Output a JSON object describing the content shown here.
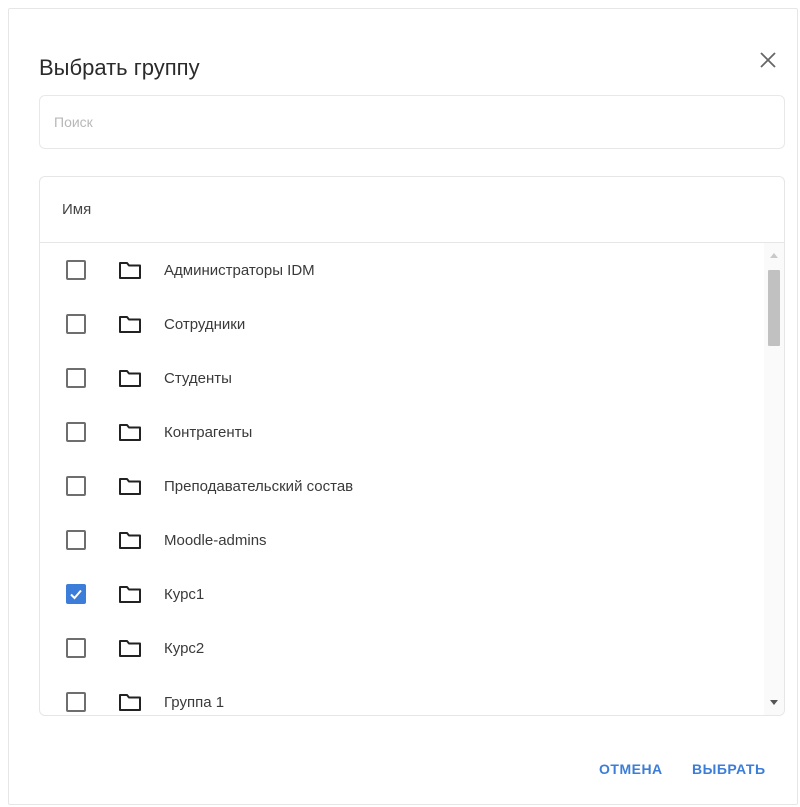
{
  "dialog": {
    "title": "Выбрать группу",
    "search": {
      "placeholder": "Поиск",
      "value": ""
    },
    "table": {
      "header": "Имя",
      "rows": [
        {
          "label": "Администраторы IDM",
          "checked": false
        },
        {
          "label": "Сотрудники",
          "checked": false
        },
        {
          "label": "Студенты",
          "checked": false
        },
        {
          "label": "Контрагенты",
          "checked": false
        },
        {
          "label": "Преподавательский состав",
          "checked": false
        },
        {
          "label": "Moodle-admins",
          "checked": false
        },
        {
          "label": "Курс1",
          "checked": true
        },
        {
          "label": "Курс2",
          "checked": false
        },
        {
          "label": "Группа 1",
          "checked": false
        }
      ]
    },
    "buttons": {
      "cancel": "ОТМЕНА",
      "select": "ВЫБРАТЬ"
    }
  },
  "colors": {
    "accent": "#3b7dd8",
    "border": "#e6e6e6"
  },
  "icons": {
    "close": "close-icon",
    "folder": "folder-icon",
    "check": "check-icon"
  }
}
